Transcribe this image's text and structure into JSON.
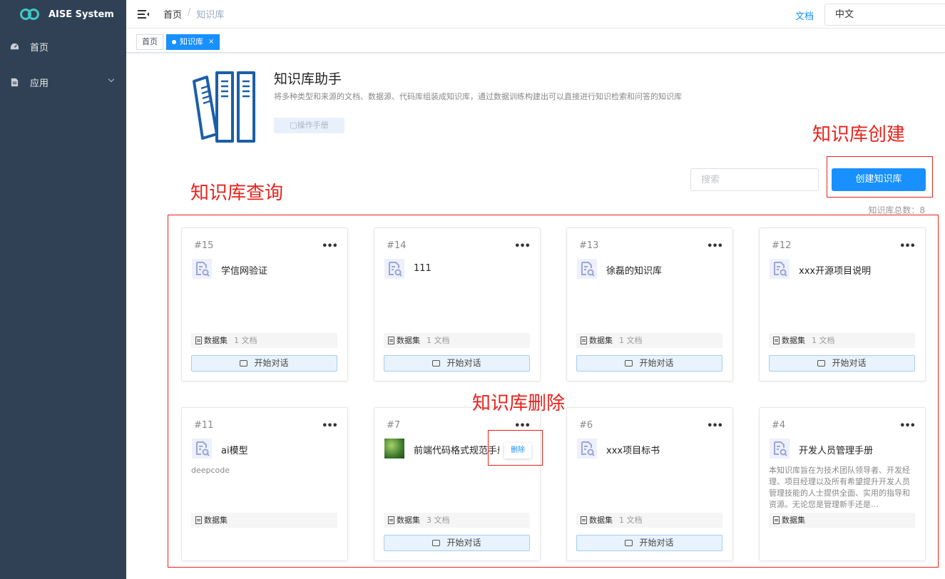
{
  "app": {
    "title": "AISE System"
  },
  "sidebar": {
    "items": [
      {
        "label": "首页",
        "icon": "dashboard-icon"
      },
      {
        "label": "应用",
        "icon": "document-icon",
        "expandable": true
      }
    ]
  },
  "topbar": {
    "breadcrumb": [
      "首页",
      "知识库"
    ],
    "breadcrumb_sep": "/",
    "docs_label": "文档",
    "language": "中文"
  },
  "tags": {
    "home": "首页",
    "active": "知识库",
    "close": "×"
  },
  "header": {
    "title": "知识库助手",
    "description": "将多种类型和来源的文档、数据源、代码库组装成知识库，通过数据训练构建出可以直接进行知识检索和问答的知识库",
    "manual_label": "操作手册"
  },
  "annotations": {
    "create": "知识库创建",
    "query": "知识库查询",
    "delete": "知识库删除",
    "color": "#e9231c"
  },
  "toolbar": {
    "search_placeholder": "搜索",
    "create_label": "创建知识库",
    "total": "知识库总数：8"
  },
  "colors": {
    "primary": "#1890ff",
    "sidebar": "#304156"
  },
  "cards": [
    {
      "id": "#15",
      "name": "学信网验证",
      "desc": "",
      "meta_label": "数据集",
      "count": "1 文档",
      "chat": "开始对话"
    },
    {
      "id": "#14",
      "name": "111",
      "desc": "",
      "meta_label": "数据集",
      "count": "1 文档",
      "chat": "开始对话"
    },
    {
      "id": "#13",
      "name": "徐磊的知识库",
      "desc": "",
      "meta_label": "数据集",
      "count": "1 文档",
      "chat": "开始对话"
    },
    {
      "id": "#12",
      "name": "xxx开源项目说明",
      "desc": "",
      "meta_label": "数据集",
      "count": "1 文档",
      "chat": "开始对话"
    },
    {
      "id": "#11",
      "name": "ai模型",
      "desc": "deepcode",
      "meta_label": "数据集",
      "count": "",
      "chat": ""
    },
    {
      "id": "#7",
      "name": "前端代码格式规范手册",
      "desc": "",
      "meta_label": "数据集",
      "count": "3 文档",
      "chat": "开始对话",
      "thumb": true,
      "delete_label": "删除"
    },
    {
      "id": "#6",
      "name": "xxx项目标书",
      "desc": "",
      "meta_label": "数据集",
      "count": "1 文档",
      "chat": "开始对话"
    },
    {
      "id": "#4",
      "name": "开发人员管理手册",
      "desc": "本知识库旨在为技术团队领导者、开发经理、项目经理以及所有希望提升开发人员管理技能的人士提供全面、实用的指导和资源。无论您是管理新手还是…",
      "meta_label": "数据集",
      "count": "",
      "chat": ""
    }
  ]
}
